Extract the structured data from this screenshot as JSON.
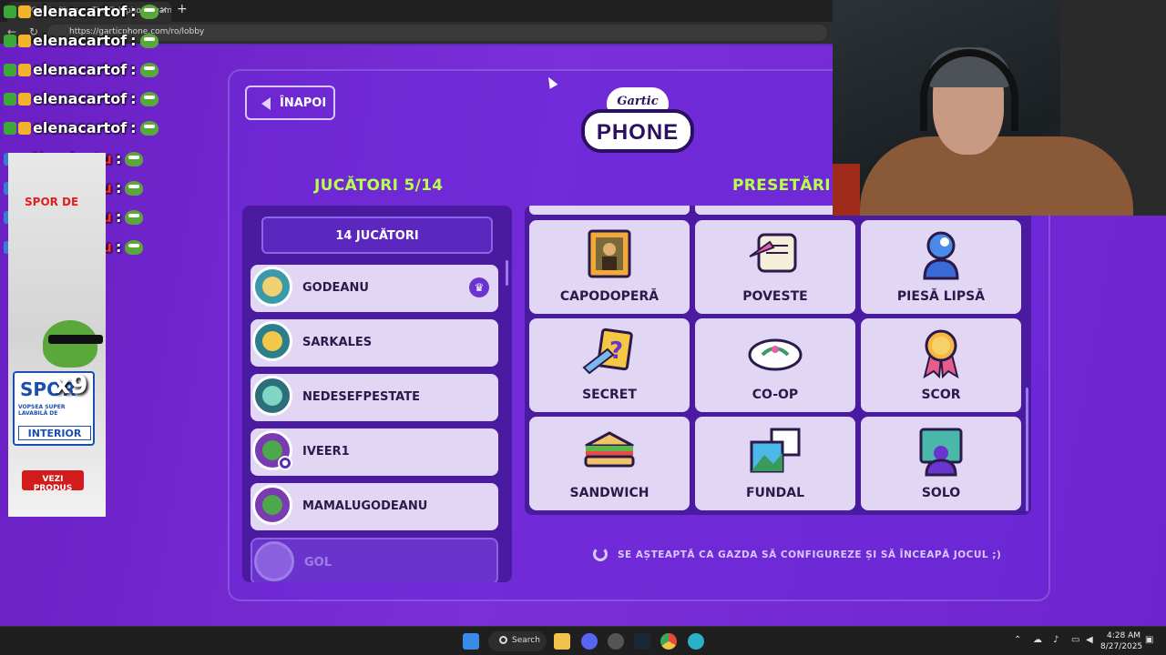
{
  "browser": {
    "tab_title": "Gartic Phone - The Telephone game",
    "new_tab_symbol": "+",
    "url": "https://garticphone.com/ro/lobby"
  },
  "game": {
    "back_label": "ÎNAPOI",
    "logo_top": "Gartic",
    "logo_bottom": "PHONE",
    "players_title": "JUCĂTORI 5/14",
    "presets_title": "PRESETĂRI",
    "player_count_button": "14 JUCĂTORI",
    "players": [
      {
        "name": "GODEANU",
        "host": true
      },
      {
        "name": "SARKALES"
      },
      {
        "name": "NEDESEFPESTATE"
      },
      {
        "name": "IVEER1"
      },
      {
        "name": "MAMALUGODEANU"
      },
      {
        "name": "GOL",
        "empty": true
      }
    ],
    "presets": [
      {
        "label": "CAPODOPERĂ",
        "icon": "mona-lisa-painting-icon"
      },
      {
        "label": "POVESTE",
        "icon": "scroll-quill-icon"
      },
      {
        "label": "PIESĂ LIPSĂ",
        "icon": "puzzle-head-icon"
      },
      {
        "label": "SECRET",
        "icon": "question-pencil-icon"
      },
      {
        "label": "CO-OP",
        "icon": "hands-drawing-icon"
      },
      {
        "label": "SCOR",
        "icon": "medal-icon"
      },
      {
        "label": "SANDWICH",
        "icon": "sandwich-icon"
      },
      {
        "label": "FUNDAL",
        "icon": "picture-background-icon"
      },
      {
        "label": "SOLO",
        "icon": "solo-screen-icon"
      }
    ],
    "waiting_text": "SE AȘTEAPTĂ CA GAZDA SĂ CONFIGUREZE ȘI SĂ ÎNCEAPĂ JOCUL ;)"
  },
  "chat": [
    {
      "user": "elenacartof",
      "color": "#ffffff"
    },
    {
      "user": "elenacartof",
      "color": "#ffffff"
    },
    {
      "user": "elenacartof",
      "color": "#ffffff"
    },
    {
      "user": "elenacartof",
      "color": "#ffffff"
    },
    {
      "user": "elenacartof",
      "color": "#ffffff"
    },
    {
      "user": "Narcisutu",
      "color": "#ff2a2a"
    },
    {
      "user": "Narcisutu",
      "color": "#ff2a2a"
    },
    {
      "user": "Narcisutu",
      "color": "#ff2a2a"
    },
    {
      "user": "Narcisutu",
      "color": "#ff2a2a"
    }
  ],
  "chat_separator": ":",
  "ad": {
    "headline": "SPOR DE",
    "brand": "SPOR",
    "sub": "VOPSEA SUPER LAVABILĂ DE",
    "interior": "INTERIOR",
    "multiplier": "x9",
    "cta": "VEZI PRODUS"
  },
  "taskbar": {
    "search_label": "Search",
    "time": "4:28 AM",
    "date": "8/27/2025"
  },
  "colors": {
    "accent_green": "#b8ff4a",
    "purple_bg": "#7b2fd9",
    "card_bg": "#e1d7f5"
  }
}
